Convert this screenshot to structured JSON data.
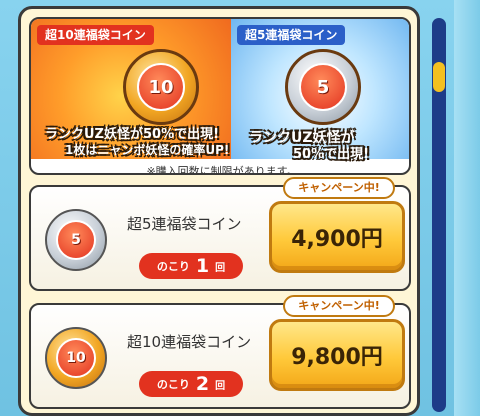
{
  "banner": {
    "left_tag": "超10連福袋コイン",
    "right_tag": "超5連福袋コイン",
    "left_coin_label": "10",
    "right_coin_label": "5",
    "left_promo_line1": "ランクUZ妖怪が50%で出現!",
    "left_promo_line2": "1枚はニャンボ妖怪の確率UP!",
    "right_promo_line1": "ランクUZ妖怪が",
    "right_promo_line2": "50%で出現!",
    "note": "※購入回数に制限があります。"
  },
  "items": [
    {
      "name": "超5連福袋コイン",
      "coin_label": "5",
      "remaining_label": "のこり",
      "remaining_count": "1",
      "remaining_unit": "回",
      "campaign": "キャンペーン中!",
      "price": "4,900円"
    },
    {
      "name": "超10連福袋コイン",
      "coin_label": "10",
      "remaining_label": "のこり",
      "remaining_count": "2",
      "remaining_unit": "回",
      "campaign": "キャンペーン中!",
      "price": "9,800円"
    }
  ],
  "scrollbar": {
    "position": 0.12
  },
  "colors": {
    "accent_red": "#e2321f",
    "accent_blue": "#2b5fc8",
    "price_gold": "#ffc93a",
    "scroll_track": "#1d3c88",
    "scroll_thumb": "#f4c020"
  }
}
